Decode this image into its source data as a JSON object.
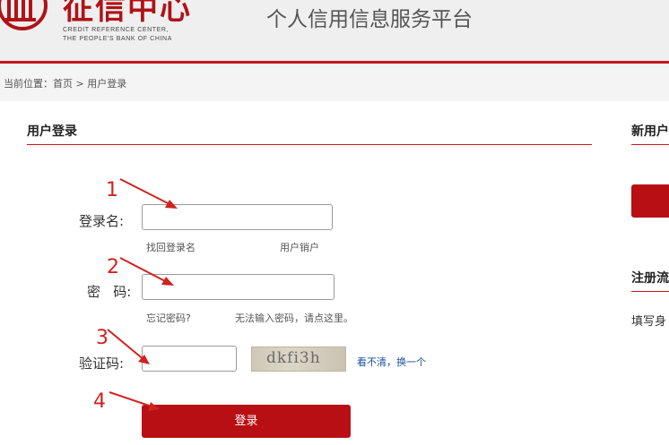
{
  "header": {
    "logo_cn": "征信中心",
    "logo_en_line1": "CREDIT REFERENCE CENTER,",
    "logo_en_line2": "THE PEOPLE'S BANK OF CHINA",
    "platform_title": "个人信用信息服务平台"
  },
  "breadcrumb": "当前位置：首页 > 用户登录",
  "login": {
    "title": "用户登录",
    "username_label": "登录名:",
    "username_value": "",
    "find_login_name": "找回登录名",
    "cancel_user": "用户销户",
    "password_label": "密   码:",
    "password_value": "",
    "forgot_password": "忘记密码?",
    "cannot_input_password": "无法输入密码，请点这里。",
    "captcha_label": "验证码:",
    "captcha_value": "",
    "captcha_text": "dkfi3h",
    "captcha_refresh": "看不清，换一个",
    "submit_label": "登录"
  },
  "right_panel": {
    "new_user_title": "新用户",
    "register_flow_title": "注册流",
    "register_flow_text": "填写身"
  },
  "annotations": [
    "1",
    "2",
    "3",
    "4"
  ],
  "colors": {
    "brand_red": "#c8161d",
    "button_red": "#b80f14",
    "annotation_red": "#d0231f",
    "link_blue": "#1a4ea0"
  }
}
